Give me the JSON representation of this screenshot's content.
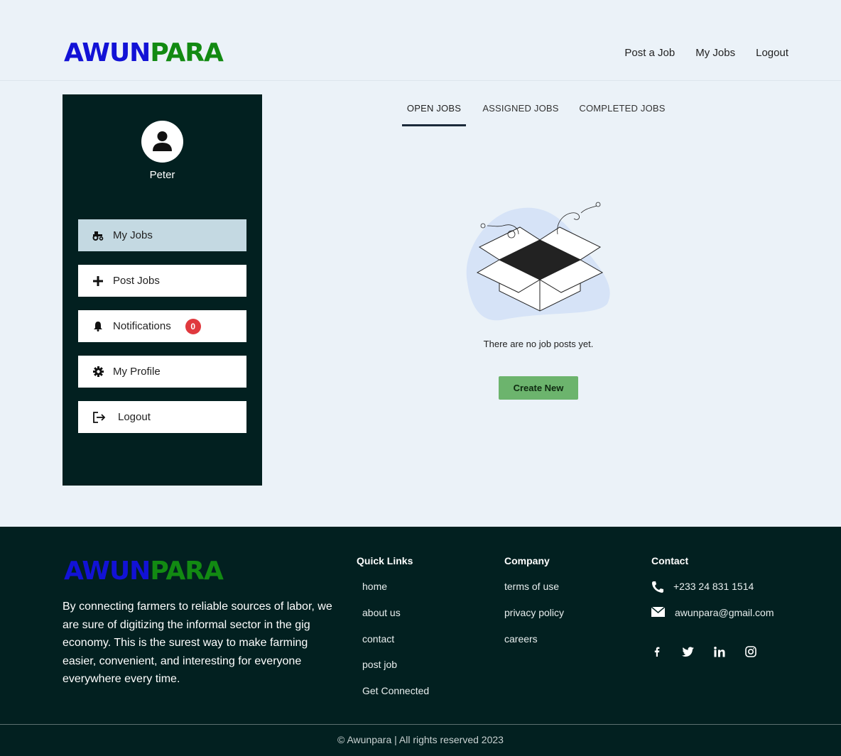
{
  "brand": {
    "part1": "AWUN",
    "part2": "PARA"
  },
  "topnav": {
    "post_job": "Post a Job",
    "my_jobs": "My Jobs",
    "logout": "Logout"
  },
  "sidebar": {
    "username": "Peter",
    "items": [
      {
        "label": "My Jobs",
        "icon": "tractor-icon"
      },
      {
        "label": "Post Jobs",
        "icon": "plus-icon"
      },
      {
        "label": "Notifications",
        "icon": "bell-icon",
        "badge": "0"
      },
      {
        "label": "My Profile",
        "icon": "gear-icon"
      },
      {
        "label": "Logout",
        "icon": "sign-out-icon"
      }
    ]
  },
  "tabs": {
    "open": "OPEN JOBS",
    "assigned": "ASSIGNED JOBS",
    "completed": "COMPLETED JOBS"
  },
  "main": {
    "empty_text": "There are no job posts yet.",
    "create_label": "Create New"
  },
  "footer": {
    "about": "By connecting farmers to reliable sources of labor, we are sure of digitizing the informal sector in the gig economy. This is the surest way to make farming easier, convenient, and interesting for everyone everywhere every time.",
    "quick_links": {
      "title": "Quick Links",
      "links": [
        "home",
        "about us",
        "contact",
        "post job",
        "Get Connected"
      ]
    },
    "company": {
      "title": "Company",
      "links": [
        "terms of use",
        "privacy policy",
        "careers"
      ]
    },
    "contact": {
      "title": "Contact",
      "phone": "+233 24 831 1514",
      "email": "awunpara@gmail.com"
    },
    "copyright": "© Awunpara | All rights reserved 2023"
  },
  "colors": {
    "brand_blue": "#1212d6",
    "brand_green": "#128a12",
    "dark": "#022020",
    "accent_green": "#6cb46d",
    "badge_red": "#e0393e"
  }
}
